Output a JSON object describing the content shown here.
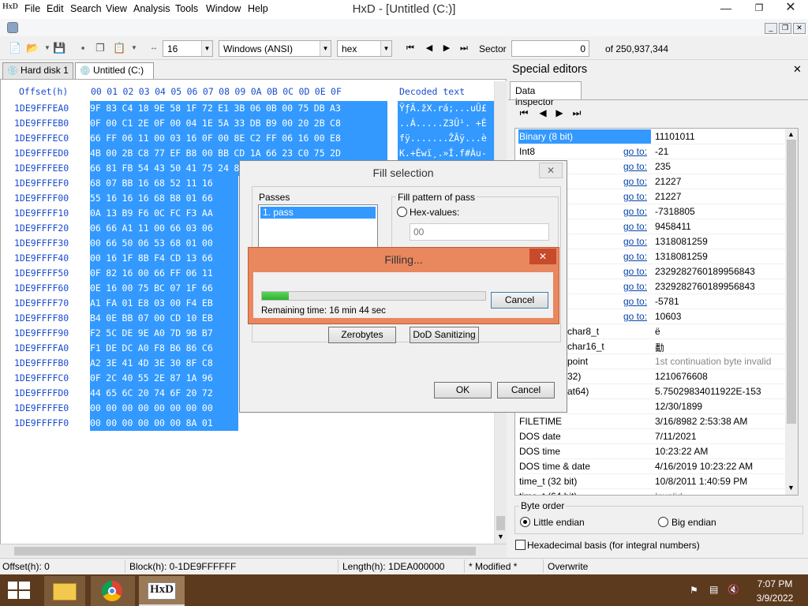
{
  "window": {
    "title": "HxD - [Untitled (C:)]",
    "logo": "HxD"
  },
  "menu": [
    "File",
    "Edit",
    "Search",
    "View",
    "Analysis",
    "Tools",
    "Window",
    "Help"
  ],
  "toolbar": {
    "bytes_per_row": "16",
    "charset": "Windows (ANSI)",
    "mode": "hex",
    "sector_label": "Sector",
    "sector_value": "0",
    "sector_total": "of 250,937,344"
  },
  "tabs": [
    "Hard disk 1",
    "Untitled (C:)"
  ],
  "hex": {
    "offset_header": "Offset(h)",
    "columns": "00 01 02 03 04 05 06 07 08 09 0A 0B 0C 0D 0E 0F",
    "decoded_header": "Decoded text",
    "rows": [
      {
        "off": "1DE9FFFEA0",
        "hex": "9F 83 C4 18 9E 58 1F 72 E1 3B 06 0B 00 75 DB A3",
        "txt": "ŸƒÄ.žX.rá;...uÛ£"
      },
      {
        "off": "1DE9FFFEB0",
        "hex": "0F 00 C1 2E 0F 00 04 1E 5A 33 DB B9 00 20 2B C8",
        "txt": "..Á.....Z3Û¹. +È"
      },
      {
        "off": "1DE9FFFEC0",
        "hex": "66 FF 06 11 00 03 16 0F 00 8E C2 FF 06 16 00 E8",
        "txt": "fÿ.......ŽÂÿ...è"
      },
      {
        "off": "1DE9FFFED0",
        "hex": "4B 00 2B C8 77 EF B8 00 BB CD 1A 66 23 C0 75 2D",
        "txt": "K.+Èwï¸.»Í.f#Àu-"
      },
      {
        "off": "1DE9FFFEE0",
        "hex": "66 81 FB 54 43 50 41 75 24 81 F9 02 01 72 1E 16",
        "txt": "f.ûTCPAu$.ù..r.."
      },
      {
        "off": "1DE9FFFEF0",
        "hex": "68 07 BB 16 68 52 11 16",
        "txt": ""
      },
      {
        "off": "1DE9FFFF00",
        "hex": "55 16 16 16 68 B8 01 66",
        "txt": ""
      },
      {
        "off": "1DE9FFFF10",
        "hex": "0A 13 B9 F6 0C FC F3 AA",
        "txt": ""
      },
      {
        "off": "1DE9FFFF20",
        "hex": "06 66 A1 11 00 66 03 06",
        "txt": ""
      },
      {
        "off": "1DE9FFFF30",
        "hex": "00 66 50 06 53 68 01 00",
        "txt": ""
      },
      {
        "off": "1DE9FFFF40",
        "hex": "00 16 1F 8B F4 CD 13 66",
        "txt": ""
      },
      {
        "off": "1DE9FFFF50",
        "hex": "0F 82 16 00 66 FF 06 11",
        "txt": ""
      },
      {
        "off": "1DE9FFFF60",
        "hex": "0E 16 00 75 BC 07 1F 66",
        "txt": ""
      },
      {
        "off": "1DE9FFFF70",
        "hex": "A1 FA 01 E8 03 00 F4 EB",
        "txt": ""
      },
      {
        "off": "1DE9FFFF80",
        "hex": "B4 0E BB 07 00 CD 10 EB",
        "txt": ""
      },
      {
        "off": "1DE9FFFF90",
        "hex": "F2 5C DE 9E A0 7D 9B B7",
        "txt": ""
      },
      {
        "off": "1DE9FFFFA0",
        "hex": "F1 DE DC A0 F8 B6 86 C6",
        "txt": ""
      },
      {
        "off": "1DE9FFFFB0",
        "hex": "A2 3E 41 4D 3E 30 8F C8",
        "txt": ""
      },
      {
        "off": "1DE9FFFFC0",
        "hex": "0F 2C 40 55 2E 87 1A 96",
        "txt": ""
      },
      {
        "off": "1DE9FFFFD0",
        "hex": "44 65 6C 20 74 6F 20 72",
        "txt": ""
      },
      {
        "off": "1DE9FFFFE0",
        "hex": "00 00 00 00 00 00 00 00",
        "txt": ""
      },
      {
        "off": "1DE9FFFFF0",
        "hex": "00 00 00 00 00 00 8A 01",
        "txt": ""
      }
    ]
  },
  "special_editors": {
    "title": "Special editors",
    "tab": "Data inspector",
    "goto": "go to:",
    "rows": [
      {
        "name": "Binary (8 bit)",
        "goto": false,
        "value": "11101011",
        "selected": true
      },
      {
        "name": "Int8",
        "goto": true,
        "value": "-21"
      },
      {
        "name": "",
        "goto": true,
        "value": "235"
      },
      {
        "name": "",
        "goto": true,
        "value": "21227"
      },
      {
        "name": "",
        "goto": true,
        "value": "21227"
      },
      {
        "name": "",
        "goto": true,
        "value": "-7318805"
      },
      {
        "name": "",
        "goto": true,
        "value": "9458411"
      },
      {
        "name": "",
        "goto": true,
        "value": "1318081259"
      },
      {
        "name": "",
        "goto": true,
        "value": "1318081259"
      },
      {
        "name": "",
        "goto": true,
        "value": "2329282760189956843"
      },
      {
        "name": "",
        "goto": true,
        "value": "2329282760189956843"
      },
      {
        "name": "",
        "goto": true,
        "value": "-5781"
      },
      {
        "name": "",
        "goto": true,
        "value": "10603"
      },
      {
        "name": "char8_t",
        "goto": false,
        "value": "ë",
        "indent": true
      },
      {
        "name": "char16_t",
        "goto": false,
        "value": "勫",
        "indent": true
      },
      {
        "name": "point",
        "goto": false,
        "value": "1st continuation byte invalid",
        "indent": true,
        "gray": true
      },
      {
        "name": "32)",
        "goto": false,
        "value": "1210676608",
        "indent": true
      },
      {
        "name": "at64)",
        "goto": false,
        "value": "5.75029834011922E-153",
        "indent": true
      },
      {
        "name": "",
        "goto": false,
        "value": "12/30/1899"
      },
      {
        "name": "FILETIME",
        "goto": false,
        "value": "3/16/8982 2:53:38 AM"
      },
      {
        "name": "DOS date",
        "goto": false,
        "value": "7/11/2021"
      },
      {
        "name": "DOS time",
        "goto": false,
        "value": "10:23:22 AM"
      },
      {
        "name": "DOS time & date",
        "goto": false,
        "value": "4/16/2019 10:23:22 AM"
      },
      {
        "name": "time_t (32 bit)",
        "goto": false,
        "value": "10/8/2011 1:40:59 PM"
      },
      {
        "name": "time_t (64 bit)",
        "goto": false,
        "value": "Invalid",
        "gray": true
      }
    ],
    "byte_order_label": "Byte order",
    "little_endian": "Little endian",
    "big_endian": "Big endian",
    "hex_basis": "Hexadecimal basis (for integral numbers)"
  },
  "fill_dialog": {
    "title": "Fill selection",
    "passes_label": "Passes",
    "pass_item": "1. pass",
    "pattern_group": "Fill pattern of pass",
    "hex_values_label": "Hex-values:",
    "hex_values_placeholder": "00",
    "zerobytes": "Zerobytes",
    "dod": "DoD Sanitizing",
    "ok": "OK",
    "cancel": "Cancel"
  },
  "filling_dialog": {
    "title": "Filling...",
    "progress": 0.12,
    "remaining": "Remaining time: 16 min 44 sec",
    "cancel": "Cancel"
  },
  "status": {
    "offset": "Offset(h): 0",
    "block": "Block(h): 0-1DE9FFFFFF",
    "length": "Length(h): 1DEA000000",
    "modified": "* Modified *",
    "mode": "Overwrite"
  },
  "taskbar": {
    "time": "7:07 PM",
    "date": "3/9/2022",
    "app_label": "HxD"
  }
}
